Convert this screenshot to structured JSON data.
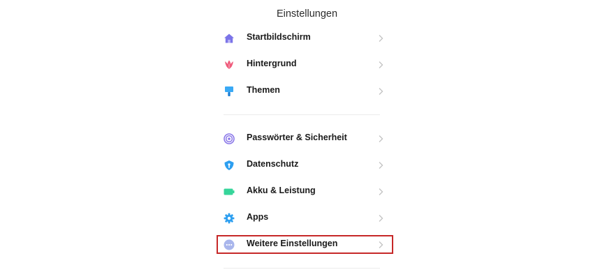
{
  "header": {
    "title": "Einstellungen"
  },
  "items": [
    {
      "label": "Startbildschirm",
      "icon": "home-icon",
      "color": "#7b74e8"
    },
    {
      "label": "Hintergrund",
      "icon": "tulip-icon",
      "color": "#ef5b7b"
    },
    {
      "label": "Themen",
      "icon": "paintbrush-icon",
      "color": "#39a9f5"
    },
    {
      "label": "Passwörter & Sicherheit",
      "icon": "fingerprint-icon",
      "color": "#8a77e8"
    },
    {
      "label": "Datenschutz",
      "icon": "privacy-shield-icon",
      "color": "#2d9ff0"
    },
    {
      "label": "Akku & Leistung",
      "icon": "battery-icon",
      "color": "#36d59a"
    },
    {
      "label": "Apps",
      "icon": "gear-icon",
      "color": "#2d9ff0"
    },
    {
      "label": "Weitere Einstellungen",
      "icon": "more-dots-icon",
      "color": "#a9b6ec"
    }
  ],
  "highlight_color": "#c62828"
}
